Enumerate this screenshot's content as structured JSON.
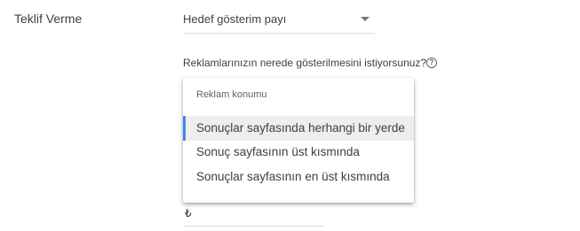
{
  "bidding": {
    "label": "Teklif Verme",
    "strategy_select": {
      "value": "Hedef gösterim payı"
    }
  },
  "placement": {
    "question": "Reklamlarınızın nerede gösterilmesini istiyorsunuz?",
    "help_icon": "help-circle-icon",
    "help_glyph": "?",
    "menu": {
      "header": "Reklam konumu",
      "items": [
        {
          "label": "Sonuçlar sayfasında herhangi bir yerde",
          "selected": true
        },
        {
          "label": "Sonuç sayfasının üst kısmında",
          "selected": false
        },
        {
          "label": "Sonuçlar sayfasının en üst kısmında",
          "selected": false
        }
      ]
    }
  },
  "amount": {
    "currency_symbol": "₺"
  },
  "colors": {
    "accent": "#4285f4",
    "selected_bg": "#eeeeee",
    "text": "#3c4043",
    "divider": "#dadce0"
  }
}
